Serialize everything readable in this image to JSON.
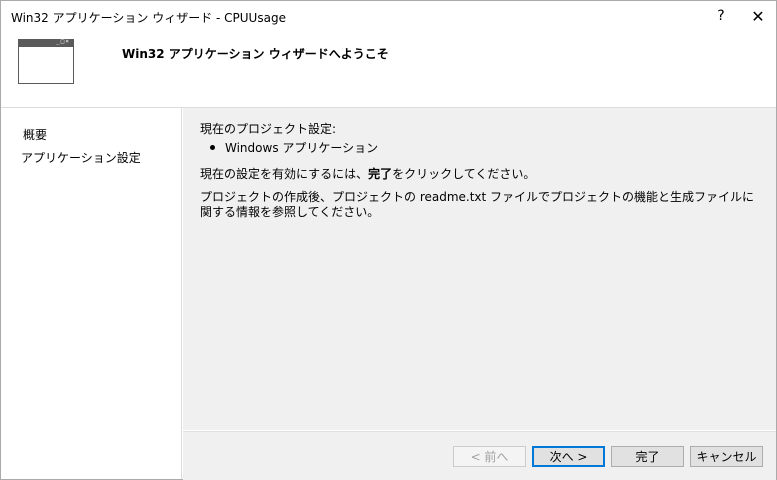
{
  "window": {
    "title": "Win32 アプリケーション ウィザード - CPUUsage",
    "help_glyph": "?",
    "close_glyph": "✕"
  },
  "header": {
    "icon_controls": "_□×",
    "title": "Win32 アプリケーション ウィザードへようこそ"
  },
  "nav": {
    "items": [
      {
        "label": "概要"
      },
      {
        "label": "アプリケーション設定"
      }
    ]
  },
  "content": {
    "current_settings_label": "現在のプロジェクト設定:",
    "bullets": [
      "Windows アプリケーション"
    ],
    "instruction_prefix": "現在の設定を有効にするには、",
    "instruction_bold": "完了",
    "instruction_suffix": "をクリックしてください。",
    "readme_text": "プロジェクトの作成後、プロジェクトの readme.txt ファイルでプロジェクトの機能と生成ファイルに関する情報を参照してください。"
  },
  "buttons": {
    "back": "< 前へ",
    "next": "次へ >",
    "finish": "完了",
    "cancel": "キャンセル"
  },
  "colors": {
    "content_bg": "#f0f0f0",
    "focus_border": "#0078d7"
  }
}
